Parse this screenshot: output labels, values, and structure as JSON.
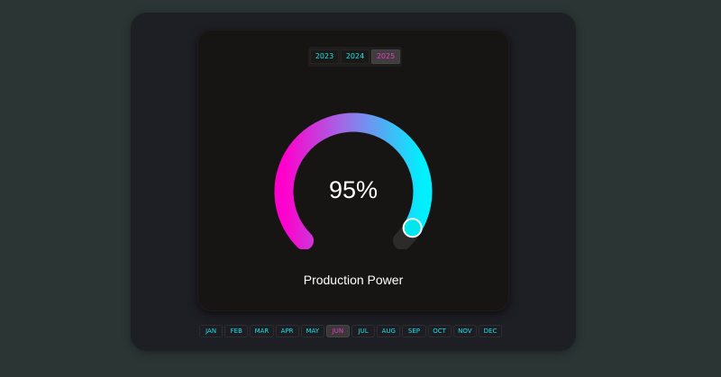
{
  "year_tabs": {
    "items": [
      {
        "label": "2023"
      },
      {
        "label": "2024"
      },
      {
        "label": "2025"
      }
    ],
    "selected": "2025"
  },
  "gauge": {
    "value": 95,
    "value_label": "95%",
    "caption": "Production Power",
    "colors": {
      "gradient_start": "#ff00cc",
      "gradient_mid": "#9a6fe8",
      "gradient_end": "#00f0ff",
      "track": "#2c2b2a",
      "knob": "#00e5ee"
    }
  },
  "month_tabs": {
    "items": [
      {
        "label": "JAN"
      },
      {
        "label": "FEB"
      },
      {
        "label": "MAR"
      },
      {
        "label": "APR"
      },
      {
        "label": "MAY"
      },
      {
        "label": "JUN"
      },
      {
        "label": "JUL"
      },
      {
        "label": "AUG"
      },
      {
        "label": "SEP"
      },
      {
        "label": "OCT"
      },
      {
        "label": "NOV"
      },
      {
        "label": "DEC"
      }
    ],
    "selected": "JUN"
  },
  "colors": {
    "accent_cyan": "#19e3ef",
    "accent_magenta": "#f23ac9"
  }
}
